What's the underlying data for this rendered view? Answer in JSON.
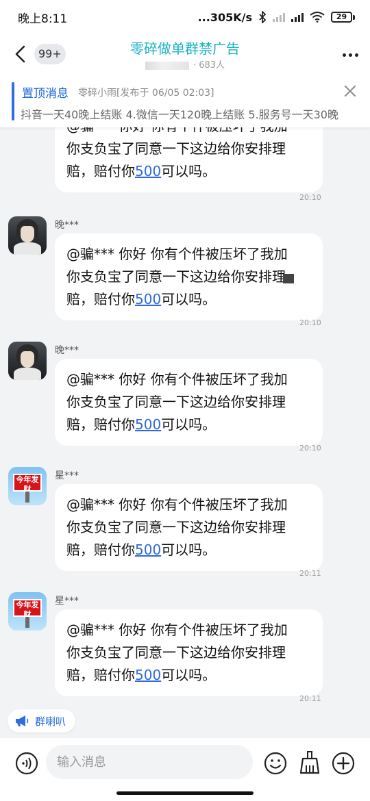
{
  "status_bar": {
    "time": "晚上8:11",
    "network_speed": "...305K/s",
    "battery": "29",
    "icons": [
      "bluetooth-icon",
      "hd-signal-icon",
      "wifi-icon",
      "battery-icon"
    ]
  },
  "nav": {
    "back_count": "99+",
    "title": "零碎做单群禁广告",
    "member_suffix": "683人",
    "title_color": "#19b2c4"
  },
  "pinned": {
    "label": "置顶消息",
    "meta": "零碎小雨[发布于 06/05 02:03]",
    "text": "抖音一天40晚上结账 4.微信一天120晚上结账 5.服务号一天30晚"
  },
  "messages": [
    {
      "sender": "",
      "avatar": "anime-avatar",
      "line1": "@骗***  你好 你有个件被压坏了我加",
      "line2": "你支负宝了同意一下这边给你安排理",
      "line3_pre": "赔，赔付你",
      "amount": "500",
      "line3_post": "可以吗。",
      "time": "20:10"
    },
    {
      "sender": "晚***",
      "avatar": "anime-avatar",
      "line1": "@骗***  你好 你有个件被压坏了我加",
      "line2": "你支负宝了同意一下这边给你安排理",
      "line3_pre": "赔，赔付你",
      "amount": "500",
      "line3_post": "可以吗。",
      "time": "20:10"
    },
    {
      "sender": "晚***",
      "avatar": "anime-avatar",
      "line1": "@骗***  你好 你有个件被压坏了我加",
      "line2": "你支负宝了同意一下这边给你安排理",
      "line3_pre": "赔，赔付你",
      "amount": "500",
      "line3_post": "可以吗。",
      "time": "20:10"
    },
    {
      "sender": "星***",
      "avatar": "sign-avatar",
      "avatar_text": "今年发财",
      "line1": "@骗***  你好 你有个件被压坏了我加",
      "line2": "你支负宝了同意一下这边给你安排理",
      "line3_pre": "赔，赔付你",
      "amount": "500",
      "line3_post": "可以吗。",
      "time": "20:11"
    },
    {
      "sender": "星***",
      "avatar": "sign-avatar",
      "avatar_text": "今年发财",
      "line1": "@骗***  你好 你有个件被压坏了我加",
      "line2": "你支负宝了同意一下这边给你安排理",
      "line3_pre": "赔，赔付你",
      "amount": "500",
      "line3_post": "可以吗。",
      "time": "20:11"
    }
  ],
  "announcement_chip": {
    "label": "群喇叭"
  },
  "input_bar": {
    "placeholder": "输入消息",
    "accent_color": "#2c6ee0"
  }
}
